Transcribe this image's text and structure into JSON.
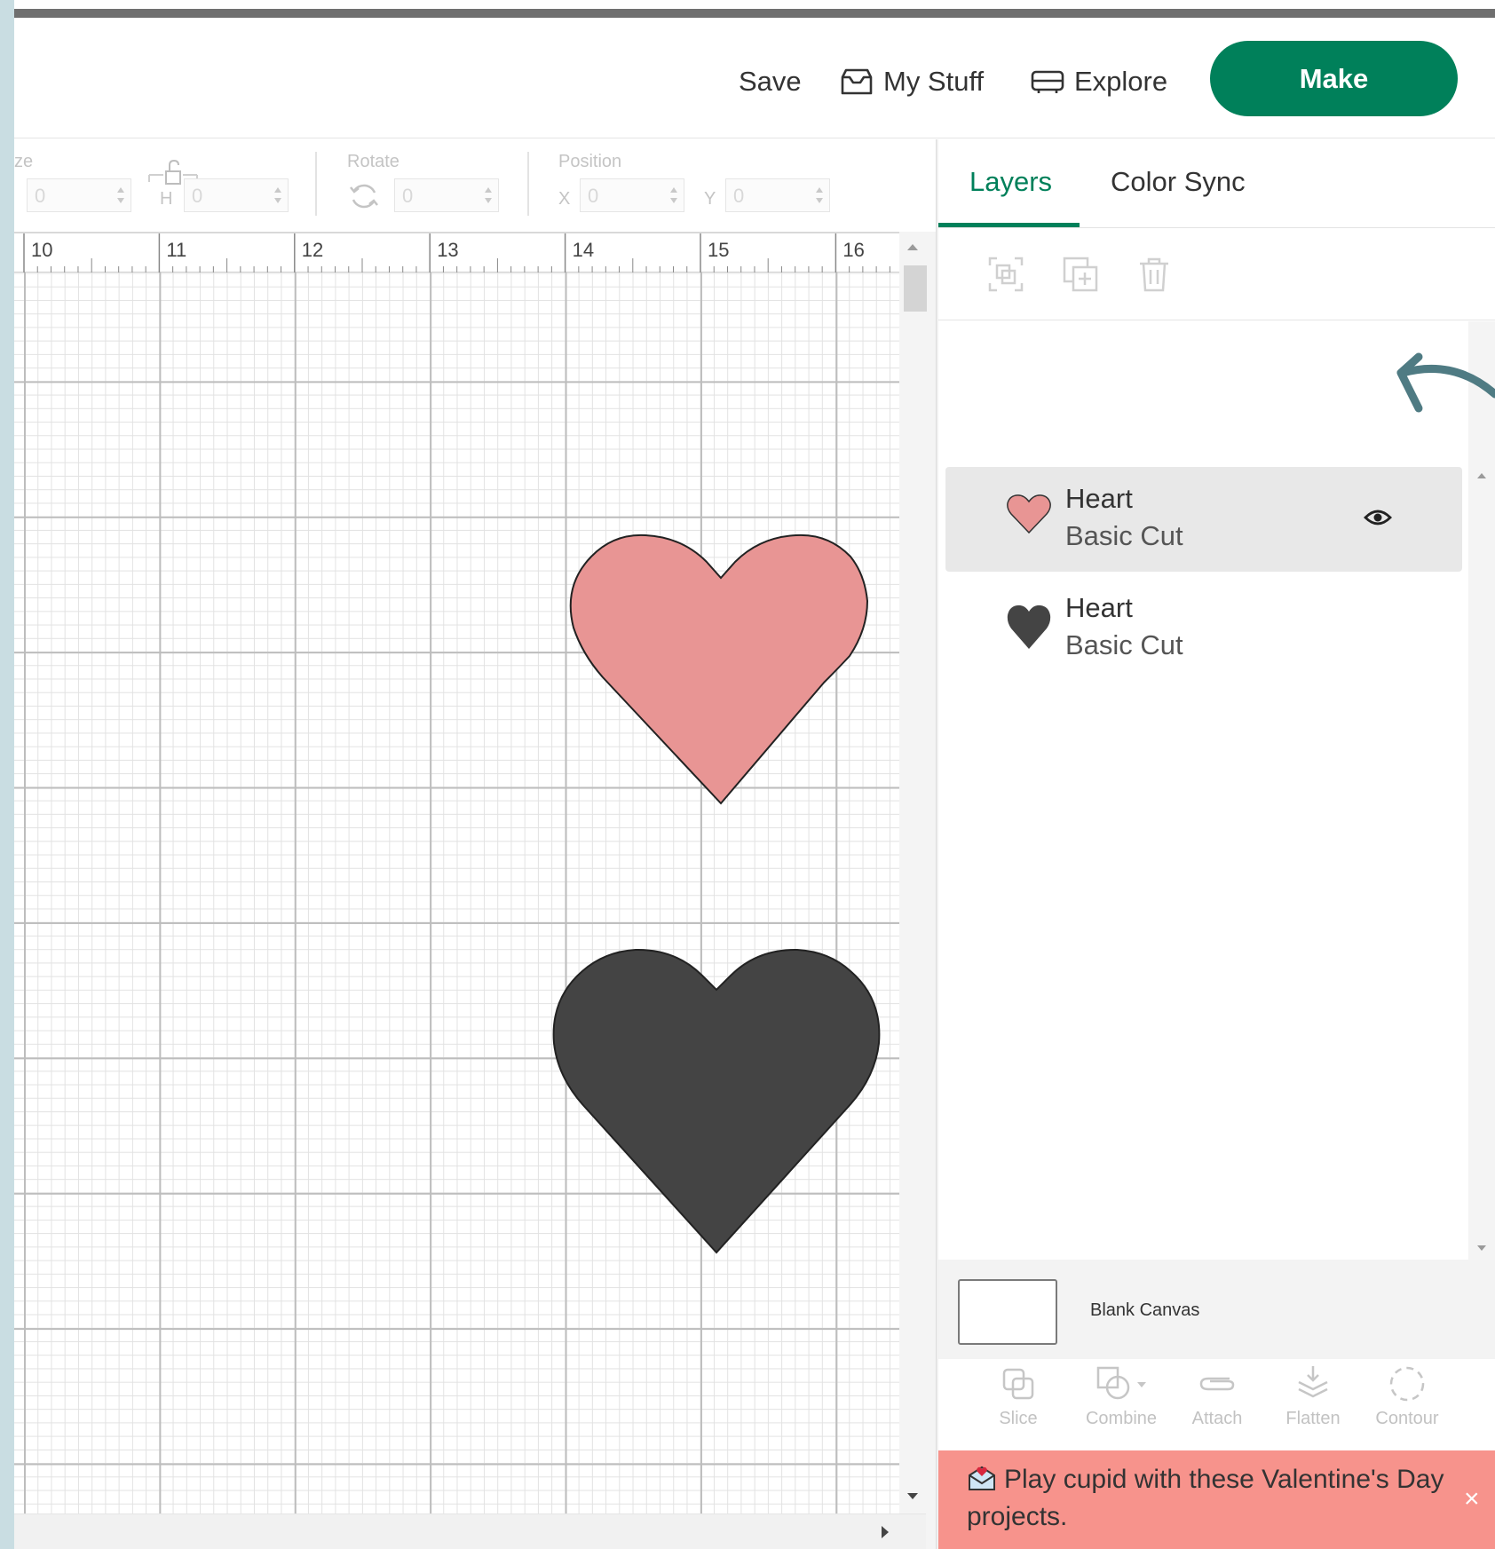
{
  "header": {
    "save_label": "Save",
    "mystuff_label": "My Stuff",
    "explore_label": "Explore",
    "make_label": "Make"
  },
  "toolbar": {
    "size_label": "ze",
    "h_label": "H",
    "rotate_label": "Rotate",
    "position_label": "Position",
    "x_label": "X",
    "y_label": "Y",
    "w_value": "0",
    "h_value": "0",
    "rotate_value": "0",
    "x_value": "0",
    "y_value": "0"
  },
  "ruler": {
    "ticks": [
      "10",
      "11",
      "12",
      "13",
      "14",
      "15",
      "16"
    ]
  },
  "canvas": {
    "shapes": [
      {
        "name": "pink-heart-shape",
        "color": "#e89594"
      },
      {
        "name": "dark-heart-shape",
        "color": "#444444"
      }
    ]
  },
  "panel": {
    "tabs": [
      {
        "label": "Layers",
        "active": true
      },
      {
        "label": "Color Sync",
        "active": false
      }
    ],
    "layer_tools": [
      "group-icon",
      "duplicate-icon",
      "delete-icon"
    ],
    "layers": [
      {
        "name": "Heart",
        "operation": "Basic Cut",
        "color": "#e89594",
        "selected": true,
        "visible_icon": "eye-icon"
      },
      {
        "name": "Heart",
        "operation": "Basic Cut",
        "color": "#444444",
        "selected": false
      }
    ],
    "blank_canvas_label": "Blank Canvas",
    "operations": [
      {
        "label": "Slice",
        "icon": "slice-icon"
      },
      {
        "label": "Combine",
        "icon": "combine-icon"
      },
      {
        "label": "Attach",
        "icon": "attach-icon"
      },
      {
        "label": "Flatten",
        "icon": "flatten-icon"
      },
      {
        "label": "Contour",
        "icon": "contour-icon"
      }
    ],
    "banner_text": "Play cupid with these Valentine's Day projects."
  },
  "colors": {
    "brand_green": "#00805a",
    "banner_pink": "#f7938c",
    "annotation_arrow": "#4f7b83"
  }
}
